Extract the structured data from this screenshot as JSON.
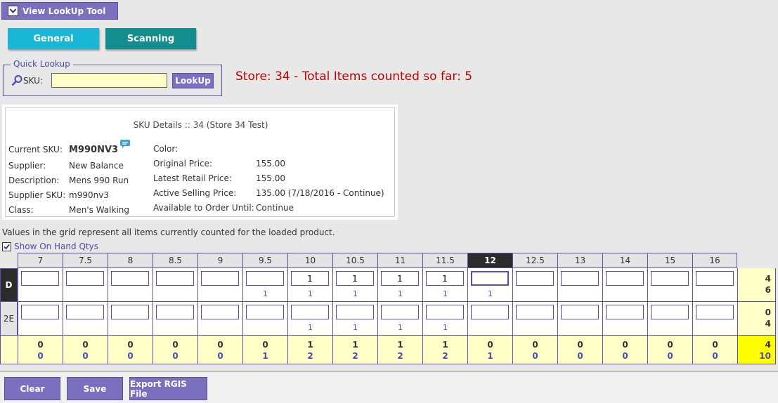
{
  "tool_button": {
    "label": "View LookUp Tool",
    "icon": "chevron-down-icon"
  },
  "tabs": [
    {
      "label": "General",
      "color": "#1ab6d5"
    },
    {
      "label": "Scanning",
      "color": "#138d8d"
    }
  ],
  "quick_lookup": {
    "legend": "Quick Lookup",
    "sku_label": "SKU:",
    "sku_value": "",
    "button_label": "LookUp",
    "icon": "search-icon"
  },
  "store_message": "Store: 34 - Total Items counted so far: 5",
  "sku_details": {
    "title": "SKU Details :: 34 (Store 34 Test)",
    "left": [
      {
        "label": "Current SKU:",
        "value": "M990NV3"
      },
      {
        "label": "Supplier:",
        "value": "New Balance"
      },
      {
        "label": "Description:",
        "value": "Mens 990 Run"
      },
      {
        "label": "Supplier SKU:",
        "value": "m990nv3"
      },
      {
        "label": "Class:",
        "value": "Men's Walking"
      }
    ],
    "right": [
      {
        "label": "Color:",
        "value": ""
      },
      {
        "label": "Original Price:",
        "value": "155.00"
      },
      {
        "label": "Latest Retail Price:",
        "value": "155.00"
      },
      {
        "label": "Active Selling Price:",
        "value": "135.00 (7/18/2016 - Continue)"
      },
      {
        "label": "Available to Order Until:",
        "value": "Continue"
      }
    ],
    "comment_icon": "chat-bubble-icon"
  },
  "grid_note": "Values in the grid represent all items currently counted for the loaded product.",
  "show_on_hand": {
    "label": "Show On Hand Qtys",
    "checked": true
  },
  "grid": {
    "sizes": [
      "7",
      "7.5",
      "8",
      "8.5",
      "9",
      "9.5",
      "10",
      "10.5",
      "11",
      "11.5",
      "12",
      "12.5",
      "13",
      "14",
      "15",
      "16"
    ],
    "selected_size": "12",
    "rows": [
      {
        "width": "D",
        "counts": [
          "",
          "",
          "",
          "",
          "",
          "",
          "1",
          "1",
          "1",
          "1",
          "",
          "",
          "",
          "",
          "",
          ""
        ],
        "on_hand": [
          "",
          "",
          "",
          "",
          "",
          "1",
          "1",
          "1",
          "1",
          "1",
          "1",
          "",
          "",
          "",
          "",
          ""
        ],
        "total_count": "4",
        "total_on_hand": "6"
      },
      {
        "width": "2E",
        "counts": [
          "",
          "",
          "",
          "",
          "",
          "",
          "",
          "",
          "",
          "",
          "",
          "",
          "",
          "",
          "",
          ""
        ],
        "on_hand": [
          "",
          "",
          "",
          "",
          "",
          "",
          "1",
          "1",
          "1",
          "1",
          "",
          "",
          "",
          "",
          "",
          ""
        ],
        "total_count": "0",
        "total_on_hand": "4"
      }
    ],
    "column_totals": {
      "counts": [
        "0",
        "0",
        "0",
        "0",
        "0",
        "0",
        "1",
        "1",
        "1",
        "1",
        "0",
        "0",
        "0",
        "0",
        "0",
        "0"
      ],
      "on_hand": [
        "0",
        "0",
        "0",
        "0",
        "0",
        "1",
        "2",
        "2",
        "2",
        "2",
        "1",
        "0",
        "0",
        "0",
        "0",
        "0"
      ]
    },
    "grand_total": {
      "count": "4",
      "on_hand": "10"
    }
  },
  "buttons": {
    "clear": "Clear",
    "save": "Save",
    "export": "Export RGIS File"
  },
  "colors": {
    "accent": "#7b6fc0",
    "highlight": "#ffffc8",
    "grand_total": "#ffff00",
    "alert": "#c00000"
  }
}
